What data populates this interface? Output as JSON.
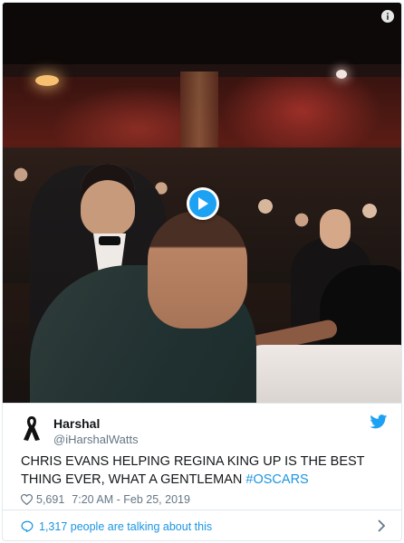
{
  "video": {
    "play_icon": "play-icon",
    "info_icon": "info-icon"
  },
  "tweet": {
    "author": {
      "name": "Harshal",
      "handle": "@iHarshalWatts",
      "avatar_icon": "black-ribbon-icon"
    },
    "brand_icon": "twitter-bird-icon",
    "text_main": "CHRIS EVANS HELPING REGINA KING UP IS THE BEST THING EVER, WHAT A GENTLEMAN ",
    "hashtag": "#OSCARS",
    "likes": "5,691",
    "like_icon": "heart-icon",
    "timestamp": "7:20 AM - Feb 25, 2019"
  },
  "footer": {
    "conversation_text": "1,317 people are talking about this",
    "conversation_icon": "speech-bubble-icon",
    "chevron_icon": "chevron-right-icon"
  },
  "colors": {
    "accent": "#1da1f2",
    "link": "#1b95e0",
    "secondary_text": "#657786",
    "border": "#e1e8ed"
  }
}
